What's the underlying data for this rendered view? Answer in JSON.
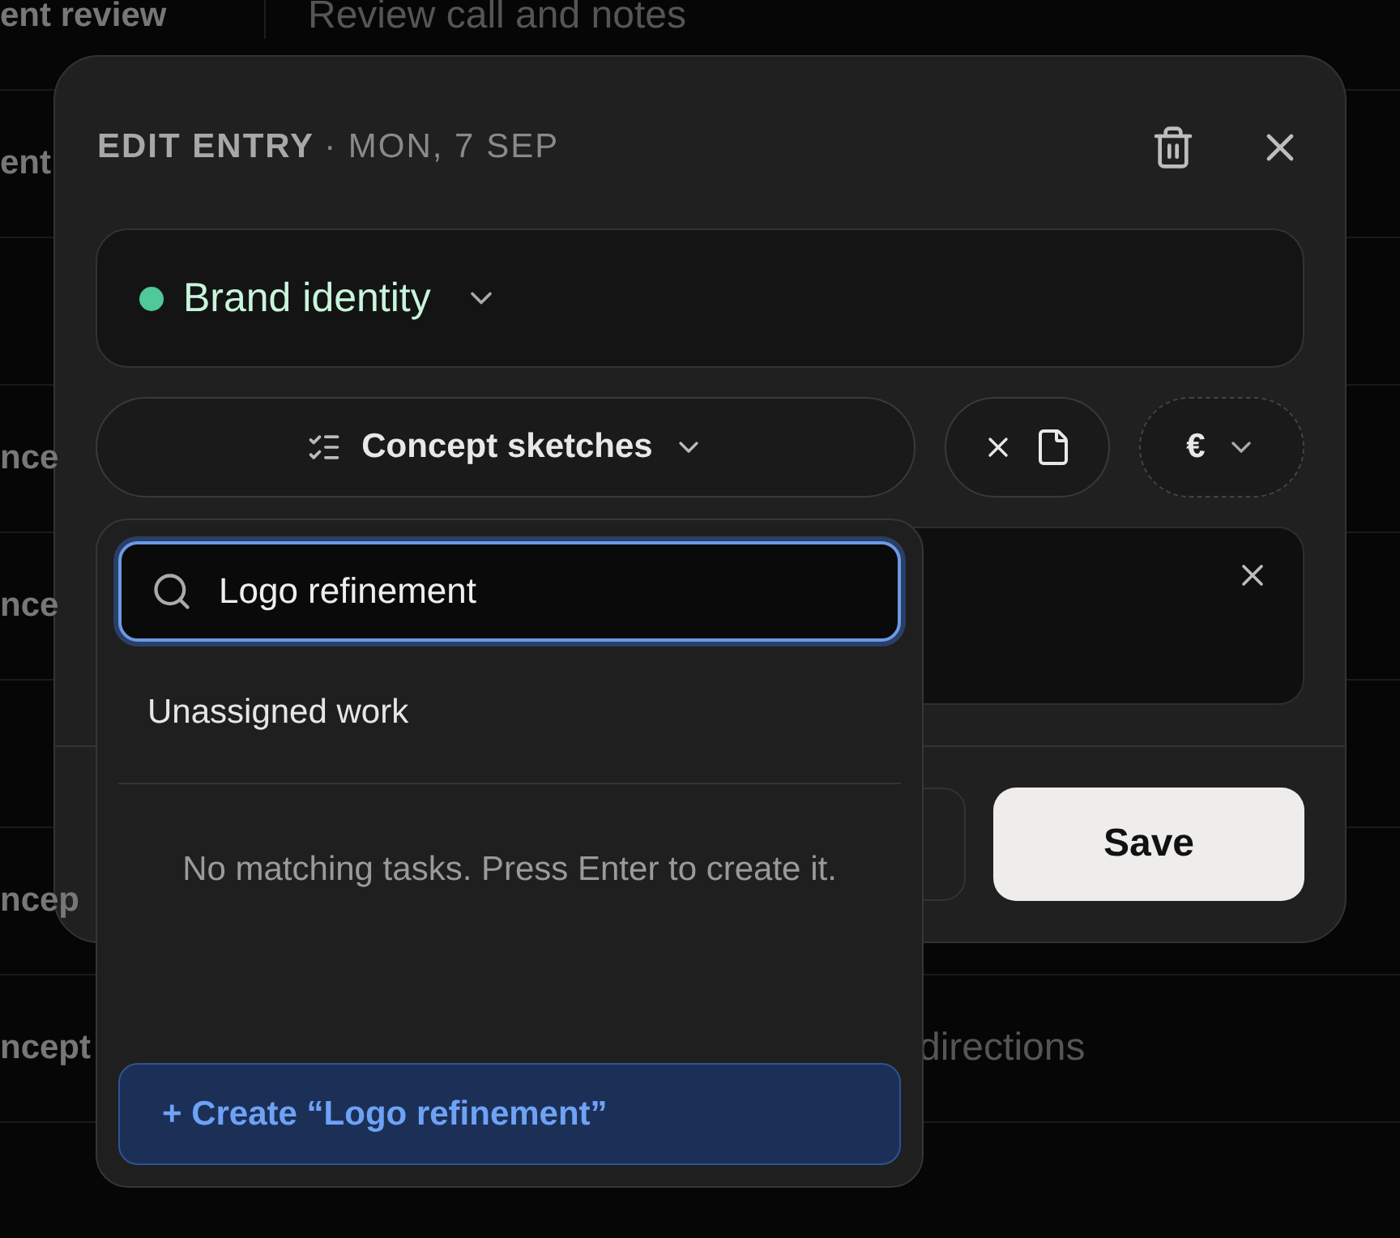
{
  "background_table": {
    "rows": [
      {
        "column_1": "ent review",
        "column_2": "Review call and notes"
      },
      {
        "column_1": "ent"
      },
      {},
      {
        "column_1": "nce"
      },
      {
        "column_1": "nce"
      },
      {},
      {
        "column_1": "ncep"
      },
      {
        "column_1": "ncept",
        "column_2": "directions"
      },
      {}
    ]
  },
  "dialog": {
    "title": "EDIT ENTRY",
    "date": "· MON, 7 SEP",
    "project": {
      "name": "Brand identity",
      "color": "#4fc99a"
    },
    "task": {
      "label": "Concept sketches"
    },
    "currency": {
      "symbol": "€"
    },
    "save_button": "Save"
  },
  "task_popover": {
    "search": {
      "value": "Logo refinement"
    },
    "options": [
      {
        "label": "Unassigned work",
        "selected": false
      }
    ],
    "empty_message": "No matching tasks. Press Enter to create it.",
    "create_button": "+ Create “Logo refinement”"
  }
}
